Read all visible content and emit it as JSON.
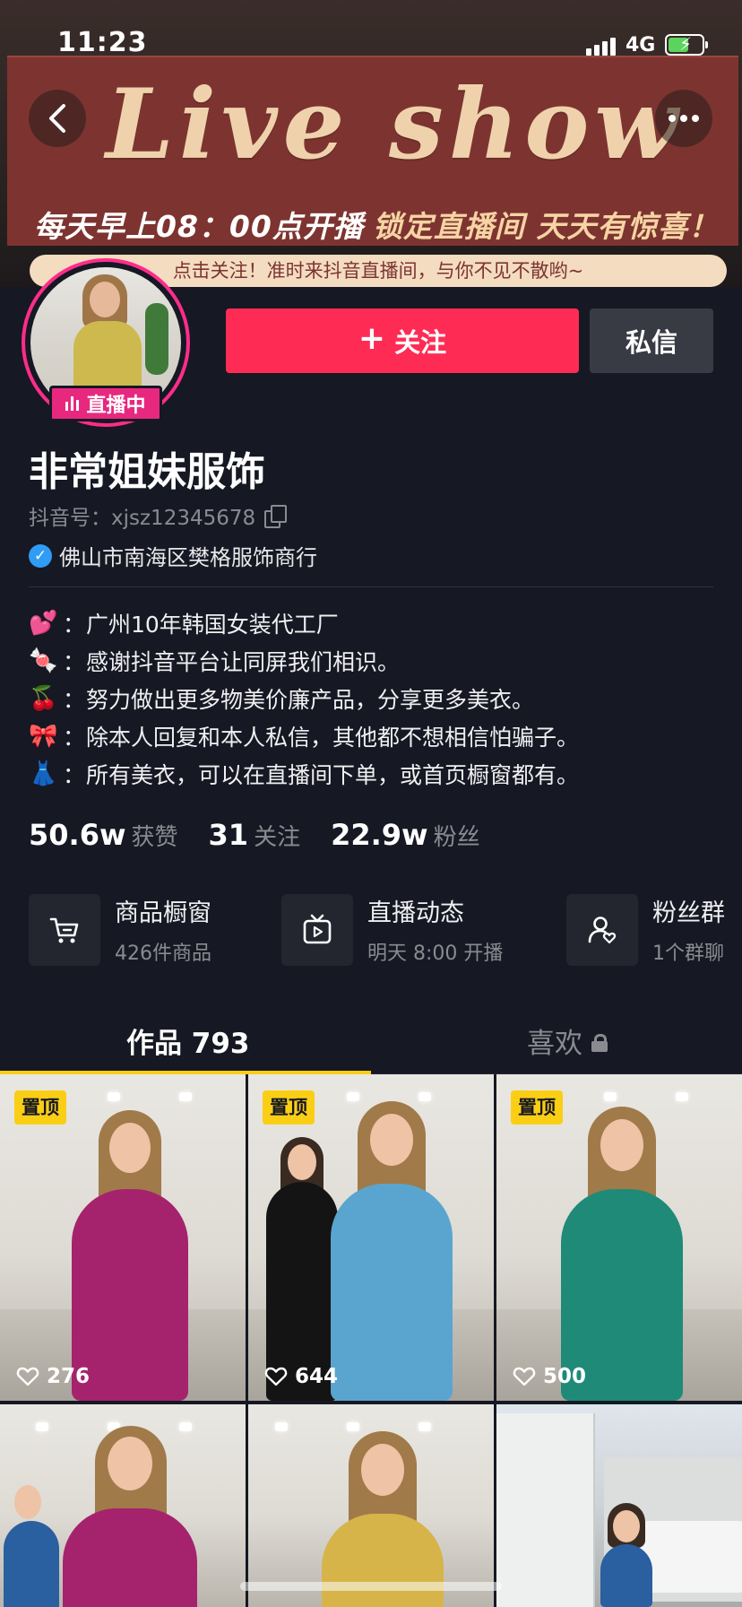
{
  "status_bar": {
    "time": "11:23",
    "network": "4G"
  },
  "banner": {
    "script_text": "Live show",
    "headline_a": "每天早上08：00点开播",
    "headline_b": "锁定直播间 天天有惊喜！",
    "pill_text": "点击关注！准时来抖音直播间，与你不见不散哟~"
  },
  "profile": {
    "live_badge": "直播中",
    "follow_label": "关注",
    "message_label": "私信",
    "nickname": "非常姐妹服饰",
    "douyin_id": "抖音号：xjsz12345678",
    "verified_name": "佛山市南海区樊格服饰商行",
    "bio": [
      {
        "emoji": "💕",
        "text": "广州10年韩国女装代工厂"
      },
      {
        "emoji": "🍬",
        "text": "感谢抖音平台让同屏我们相识。"
      },
      {
        "emoji": "🍒",
        "text": "努力做出更多物美价廉产品，分享更多美衣。"
      },
      {
        "emoji": "🎀",
        "text": "除本人回复和本人私信，其他都不想相信怕骗子。"
      },
      {
        "emoji": "👗",
        "text": "所有美衣，可以在直播间下单，或首页橱窗都有。"
      }
    ],
    "colon": "：",
    "stats": [
      {
        "num": "50.6w",
        "label": "获赞"
      },
      {
        "num": "31",
        "label": "关注"
      },
      {
        "num": "22.9w",
        "label": "粉丝"
      }
    ]
  },
  "services": [
    {
      "icon": "cart-icon",
      "title": "商品橱窗",
      "sub": "426件商品"
    },
    {
      "icon": "tv-play-icon",
      "title": "直播动态",
      "sub": "明天 8:00 开播"
    },
    {
      "icon": "fans-group-icon",
      "title": "粉丝群",
      "sub": "1个群聊"
    }
  ],
  "tabs": {
    "works": "作品 793",
    "likes": "喜欢"
  },
  "videos": [
    {
      "pinned": "置顶",
      "likes": "276",
      "outfit": "#a5236d"
    },
    {
      "pinned": "置顶",
      "likes": "644",
      "outfit": "#5aa5cf"
    },
    {
      "pinned": "置顶",
      "likes": "500",
      "outfit": "#1f8a78"
    },
    {
      "pinned": "",
      "likes": "",
      "outfit": "#a5236d"
    },
    {
      "pinned": "",
      "likes": "",
      "outfit": "#d6b44a"
    },
    {
      "pinned": "",
      "likes": "",
      "outfit": "#2a5fa0"
    }
  ],
  "colors": {
    "accent": "#fe2c55",
    "live": "#e8287f",
    "pin": "#face15",
    "bg": "#161823"
  }
}
